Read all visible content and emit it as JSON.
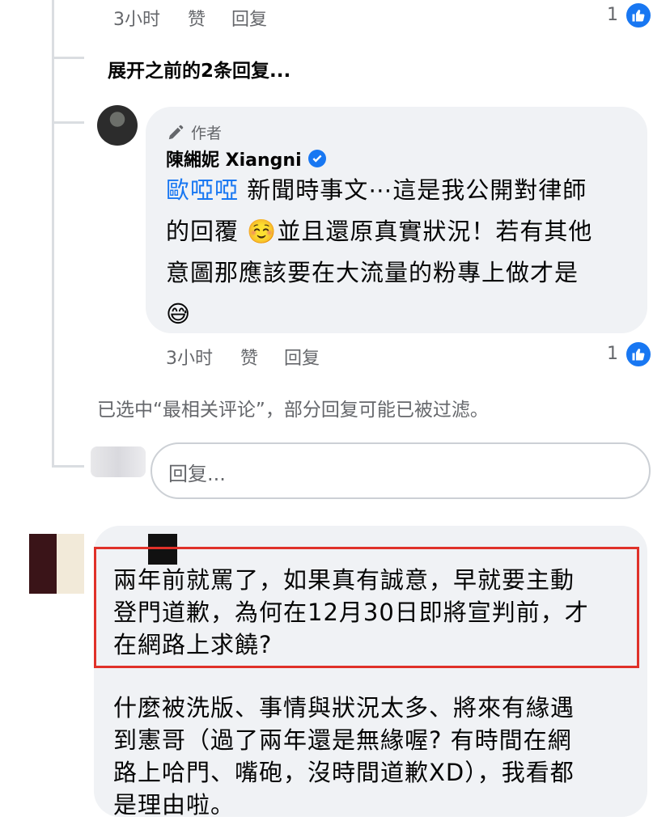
{
  "top_comment": {
    "time": "3小时",
    "like_label": "赞",
    "reply_label": "回复",
    "like_count": "1"
  },
  "expand_previous": "展开之前的2条回复...",
  "author_reply": {
    "author_badge": "作者",
    "author_name": "陳緗妮 Xiangni",
    "mention": "歐啞啞",
    "line1_rest": " 新聞時事文⋯這是我公開對律師",
    "line2": "的回覆 ☺️並且還原真實狀況！若有其他",
    "line3": "意圖那應該要在大流量的粉專上做才是",
    "line4": "😅",
    "time": "3小时",
    "like_label": "赞",
    "reply_label": "回复",
    "like_count": "1"
  },
  "filter_note": "已选中“最相关评论”，部分回复可能已被过滤。",
  "reply_input": {
    "placeholder": "回复..."
  },
  "next_comment": {
    "highlighted_line1": "兩年前就罵了，如果真有誠意，早就要主動",
    "highlighted_line2": "登門道歉，為何在12月30日即將宣判前，才",
    "highlighted_line3": "在網路上求饒?",
    "para2_line1": "什麼被洗版、事情與狀況太多、將來有緣遇",
    "para2_line2": "到憲哥（過了兩年還是無緣喔? 有時間在網",
    "para2_line3": "路上哈門、嘴砲，沒時間道歉XD），我看都",
    "para2_line4": "是理由啦。"
  },
  "colors": {
    "accent": "#1877f2",
    "bubble": "#f0f2f5",
    "highlight": "#e03129",
    "meta_text": "#65676b"
  },
  "icons": {
    "like": "thumbs-up-icon",
    "verified": "verified-badge-icon",
    "author": "pen-icon"
  }
}
